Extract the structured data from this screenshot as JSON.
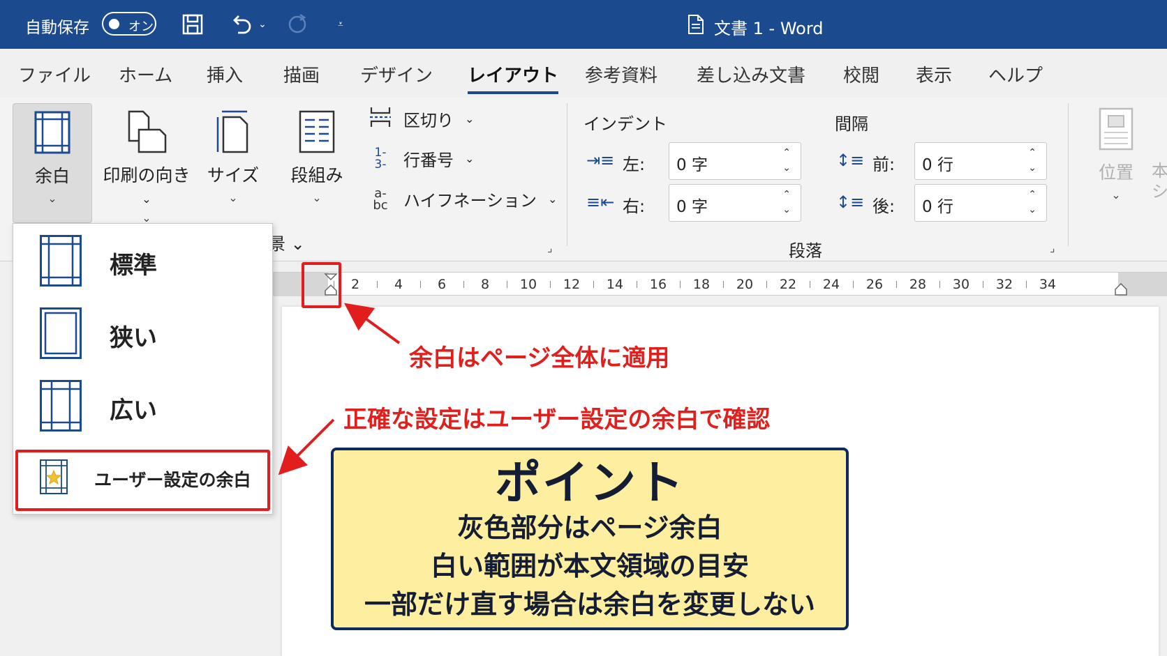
{
  "titlebar": {
    "autosave_label": "自動保存",
    "toggle_label": "オン",
    "doc_title": "文書 1  -  Word",
    "icons": [
      "save-icon",
      "undo-icon",
      "redo-icon",
      "customize-toolbar-icon",
      "document-icon"
    ]
  },
  "tabs": [
    {
      "label": "ファイル"
    },
    {
      "label": "ホーム"
    },
    {
      "label": "挿入"
    },
    {
      "label": "描画"
    },
    {
      "label": "デザイン"
    },
    {
      "label": "レイアウト",
      "active": true
    },
    {
      "label": "参考資料"
    },
    {
      "label": "差し込み文書"
    },
    {
      "label": "校閲"
    },
    {
      "label": "表示"
    },
    {
      "label": "ヘルプ"
    }
  ],
  "ribbon": {
    "margins_label": "余白",
    "orientation_label": "印刷の向き",
    "size_label": "サイズ",
    "columns_label": "段組み",
    "breaks_label": "区切り",
    "line_numbers_label": "行番号",
    "hyphenation_label": "ハイフネーション",
    "indent_title": "インデント",
    "indent_left_label": "左:",
    "indent_left_value": "0 字",
    "indent_right_label": "右:",
    "indent_right_value": "0 字",
    "spacing_title": "間隔",
    "spacing_before_label": "前:",
    "spacing_before_value": "0 行",
    "spacing_after_label": "後:",
    "spacing_after_value": "0 行",
    "paragraph_group_label": "段落",
    "position_label": "位置",
    "wrap_label_partial": "本\nシ",
    "hidden_group_label_partial": "景 ⌄"
  },
  "margins_menu": {
    "items": [
      {
        "label": "標準"
      },
      {
        "label": "狭い"
      },
      {
        "label": "広い"
      },
      {
        "label": "ユーザー設定の余白"
      }
    ]
  },
  "ruler": {
    "numbers": [
      "2",
      "4",
      "6",
      "8",
      "10",
      "12",
      "14",
      "16",
      "18",
      "20",
      "22",
      "24",
      "26",
      "28",
      "30",
      "32",
      "34"
    ]
  },
  "annotations": {
    "note_top": "余白はページ全体に適用",
    "note_middle": "正確な設定はユーザー設定の余白で確認",
    "point_title": "ポイント",
    "point_lines": [
      "灰色部分はページ余白",
      "白い範囲が本文領域の目安",
      "一部だけ直す場合は余白を変更しない"
    ],
    "accent_color": "#e21d1d",
    "point_bg": "#fdeea0"
  }
}
